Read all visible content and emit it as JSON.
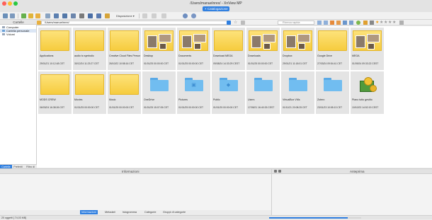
{
  "window": {
    "title": "/Users/manuelnrex/ - XnView MP",
    "tab_label": "Catalogazione"
  },
  "toolbar": {
    "view_dropdown": "Disposizione",
    "icons": [
      "browse-icon",
      "fullscreen-icon",
      "refresh-icon",
      "go-up-icon",
      "open-icon",
      "print-icon",
      "move-icon",
      "copy-icon",
      "rotate-icon",
      "filter-icon",
      "convert-icon",
      "slideshow-icon",
      "settings-icon",
      "help-icon"
    ]
  },
  "left_panel": {
    "title": "Cartelle",
    "tree": [
      {
        "label": "Computer",
        "selected": false
      },
      {
        "label": "Cartella personale",
        "selected": true
      },
      {
        "label": "Volumi",
        "selected": false
      }
    ],
    "tabs": [
      {
        "label": "Cartelle",
        "active": true
      },
      {
        "label": "Preferiti",
        "active": false
      },
      {
        "label": "Filtro di",
        "active": false
      }
    ]
  },
  "address": {
    "path": "/Users/manuelnrex/",
    "search_placeholder": "Ricerca rapida"
  },
  "files": [
    {
      "name": "Applications",
      "date": "29/01/21 10:12:48 CET",
      "thumb": "folder"
    },
    {
      "name": "audio to symbolic",
      "date": "30/12/24 11:23:27 CET",
      "thumb": "folder"
    },
    {
      "name": "Creative Cloud Files Personal...",
      "date": "26/10/22 10:58:16 CET",
      "thumb": "folder"
    },
    {
      "name": "Desktop",
      "date": "01/01/25 00:00:00 CET",
      "thumb": "photos"
    },
    {
      "name": "Documents",
      "date": "01/01/25 00:00:00 CET",
      "thumb": "photos"
    },
    {
      "name": "Download MEGA",
      "date": "09/08/24 14:33:29 CEST",
      "thumb": "folder"
    },
    {
      "name": "Downloads",
      "date": "01/01/25 00:00:00 CET",
      "thumb": "photos"
    },
    {
      "name": "Dropbox",
      "date": "29/01/21 11:18:01 CET",
      "thumb": "photos"
    },
    {
      "name": "Google Drive",
      "date": "27/03/24 09:54:41 CET",
      "thumb": "folder"
    },
    {
      "name": "MEGA",
      "date": "01/09/24 09:33:22 CEST",
      "thumb": "photos"
    },
    {
      "name": "MODS CREW",
      "date": "06/03/24 16:38:26 CET",
      "thumb": "folder"
    },
    {
      "name": "Movies",
      "date": "01/01/25 00:00:00 CET",
      "thumb": "folder"
    },
    {
      "name": "Music",
      "date": "01/01/25 00:00:00 CET",
      "thumb": "folder"
    },
    {
      "name": "OneDrive",
      "date": "01/01/25 15:07:05 CET",
      "thumb": "blue",
      "glyph": ""
    },
    {
      "name": "Pictures",
      "date": "01/01/25 00:00:00 CET",
      "thumb": "blue",
      "glyph": "▣"
    },
    {
      "name": "Public",
      "date": "01/01/25 00:00:00 CET",
      "thumb": "blue",
      "glyph": "◆"
    },
    {
      "name": "Users",
      "date": "17/05/21 16:40:33 CEST",
      "thumb": "blue",
      "glyph": ""
    },
    {
      "name": "VirtualBox VMs",
      "date": "01/11/21 20:08:25 CET",
      "thumb": "blue",
      "glyph": ""
    },
    {
      "name": "Zotero",
      "date": "23/01/23 10:55:13 CET",
      "thumb": "blue",
      "glyph": ""
    },
    {
      "name": "Piano tutto gestito",
      "date": "10/10/23 14:52:19 CEST",
      "thumb": "money"
    }
  ],
  "bottom": {
    "info_title": "Informazioni",
    "preview_title": "Anteprima",
    "tabs": [
      {
        "label": "Informazioni",
        "active": true
      },
      {
        "label": "Metadati",
        "active": false
      },
      {
        "label": "Istogramma",
        "active": false
      },
      {
        "label": "Categorie",
        "active": false
      },
      {
        "label": "Gruppi di categorie",
        "active": false
      }
    ]
  },
  "status": {
    "text": "20 oggetti [ 74,03 MB]",
    "progress": 0.85
  },
  "colors": {
    "accent": "#2f7fe0",
    "folder_yellow": "#f6cc3e",
    "folder_blue": "#71bdf0",
    "selection": "#dbe6f5"
  }
}
